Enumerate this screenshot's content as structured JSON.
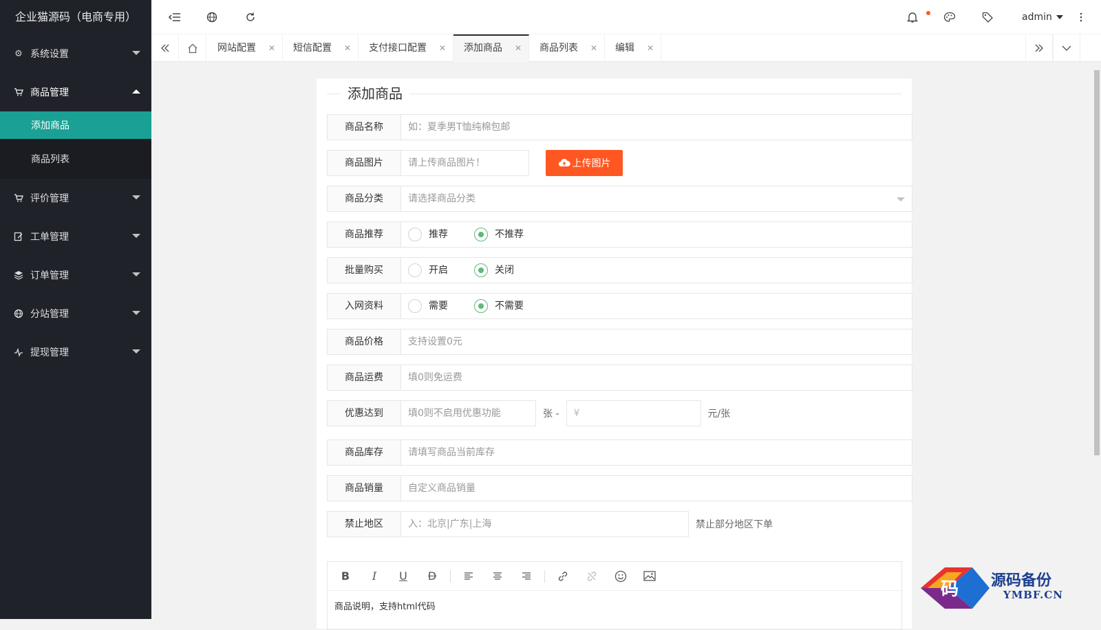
{
  "app_title": "企业猫源码（电商专用）",
  "sidebar": {
    "items": [
      {
        "label": "系统设置",
        "icon": "gear-icon"
      },
      {
        "label": "商品管理",
        "icon": "cart-icon",
        "open": true
      },
      {
        "label": "评价管理",
        "icon": "cart-icon"
      },
      {
        "label": "工单管理",
        "icon": "edit-icon"
      },
      {
        "label": "订单管理",
        "icon": "layers-icon"
      },
      {
        "label": "分站管理",
        "icon": "globe-icon"
      },
      {
        "label": "提现管理",
        "icon": "pulse-icon"
      }
    ],
    "sub_items": [
      {
        "label": "添加商品",
        "active": true
      },
      {
        "label": "商品列表",
        "active": false
      }
    ]
  },
  "header": {
    "user": "admin"
  },
  "tabs": [
    {
      "label": "网站配置"
    },
    {
      "label": "短信配置"
    },
    {
      "label": "支付接口配置"
    },
    {
      "label": "添加商品",
      "active": true
    },
    {
      "label": "商品列表"
    },
    {
      "label": "编辑"
    }
  ],
  "form": {
    "title": "添加商品",
    "name": {
      "label": "商品名称",
      "placeholder": "如：夏季男T恤纯棉包邮"
    },
    "image": {
      "label": "商品图片",
      "placeholder": "请上传商品图片！",
      "button": "上传图片"
    },
    "category": {
      "label": "商品分类",
      "placeholder": "请选择商品分类"
    },
    "recommend": {
      "label": "商品推荐",
      "options": [
        "推荐",
        "不推荐"
      ],
      "selected": "不推荐"
    },
    "bulk": {
      "label": "批量购买",
      "options": [
        "开启",
        "关闭"
      ],
      "selected": "关闭"
    },
    "network_info": {
      "label": "入网资料",
      "options": [
        "需要",
        "不需要"
      ],
      "selected": "不需要"
    },
    "price": {
      "label": "商品价格",
      "placeholder": "支持设置0元"
    },
    "shipping": {
      "label": "商品运费",
      "placeholder": "填0则免运费"
    },
    "discount": {
      "label": "优惠达到",
      "placeholder": "填0则不启用优惠功能",
      "mid_text": "张 -",
      "price_placeholder": "¥",
      "unit": "元/张"
    },
    "stock": {
      "label": "商品库存",
      "placeholder": "请填写商品当前库存"
    },
    "sales": {
      "label": "商品销量",
      "placeholder": "自定义商品销量"
    },
    "banned_region": {
      "label": "禁止地区",
      "placeholder": "入：北京|广东|上海",
      "hint": "禁止部分地区下单"
    },
    "editor": {
      "content": "商品说明，支持html代码"
    }
  },
  "watermark": {
    "title": "源码备份",
    "subtitle": "YMBF.CN",
    "glyph": "码"
  },
  "colors": {
    "sidebar": "#20222a",
    "active": "#1aa094",
    "upload": "#FF5722",
    "radio": "#5FB878"
  }
}
